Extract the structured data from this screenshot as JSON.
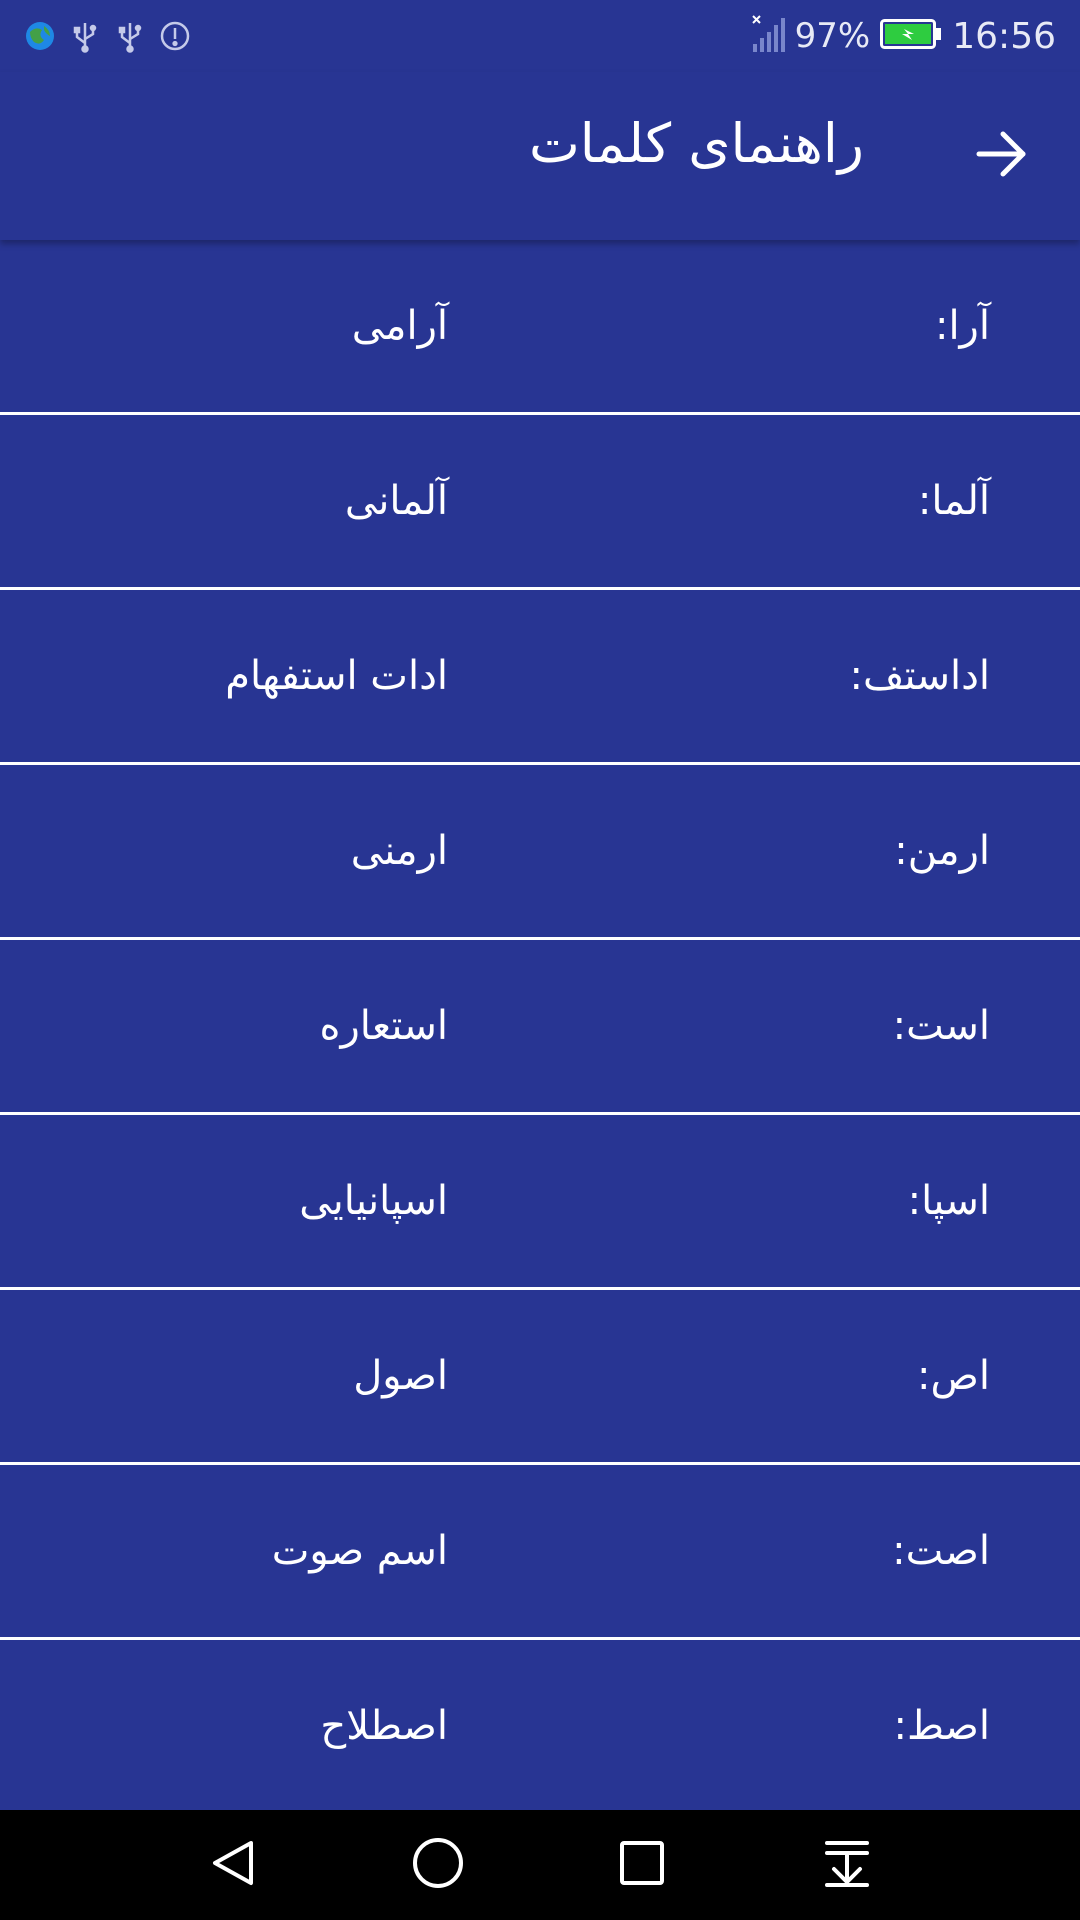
{
  "status_bar": {
    "battery_percent": "97%",
    "time": "16:56",
    "left_icons": [
      "globe-icon",
      "usb-icon",
      "usb-icon",
      "alert-icon"
    ],
    "right_icons": [
      "signal-icon",
      "battery-charging-icon"
    ]
  },
  "app_bar": {
    "title": "راهنمای کلمات",
    "back_icon": "arrow-right-icon"
  },
  "list": {
    "items": [
      {
        "abbr": "آرا:",
        "meaning": "آرامی"
      },
      {
        "abbr": "آلما:",
        "meaning": "آلمانی"
      },
      {
        "abbr": "اداستف:",
        "meaning": "ادات استفهام"
      },
      {
        "abbr": "ارمن:",
        "meaning": "ارمنی"
      },
      {
        "abbr": "است:",
        "meaning": "استعاره"
      },
      {
        "abbr": "اسپا:",
        "meaning": "اسپانیایی"
      },
      {
        "abbr": "اص:",
        "meaning": "اصول"
      },
      {
        "abbr": "اصت:",
        "meaning": "اسم صوت"
      },
      {
        "abbr": "اصط:",
        "meaning": "اصطلاح"
      }
    ]
  },
  "nav_bar": {
    "buttons": [
      "back-triangle-icon",
      "home-circle-icon",
      "recents-square-icon",
      "notifications-pulldown-icon"
    ]
  },
  "colors": {
    "background": "#283593",
    "text": "#ffffff",
    "divider": "#ffffff",
    "nav_bar": "#000000",
    "battery": "#2ecc40"
  }
}
